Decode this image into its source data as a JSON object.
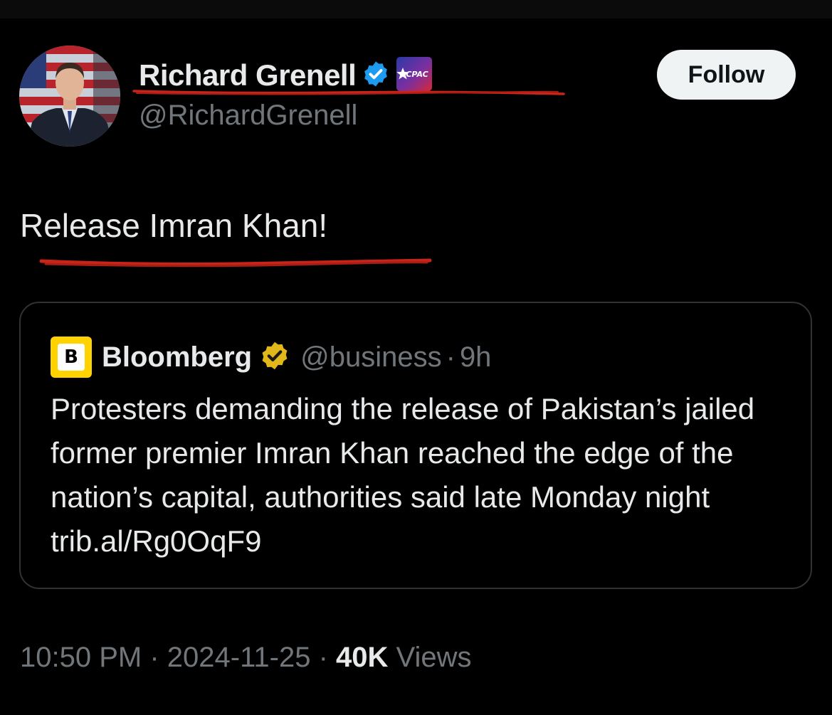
{
  "author": {
    "display_name": "Richard Grenell",
    "handle": "@RichardGrenell",
    "affiliate_badge_text": "CPAC"
  },
  "follow_button": {
    "label": "Follow"
  },
  "tweet": {
    "text": "Release Imran Khan!"
  },
  "quoted_tweet": {
    "logo_letter": "B",
    "name": "Bloomberg",
    "handle": "@business",
    "separator": "·",
    "time": "9h",
    "text": "Protesters demanding the release of Pakistan’s jailed former premier Imran Khan reached the edge of the nation’s capital, authorities said late Monday night trib.al/Rg0OqF9"
  },
  "meta": {
    "time": "10:50 PM",
    "separator": "·",
    "date": "2024-11-25",
    "views_count": "40K",
    "views_label": "Views"
  },
  "colors": {
    "background": "#000000",
    "text_primary": "#e7e9ea",
    "text_secondary": "#71767b",
    "verified_blue": "#1d9bf0",
    "verified_gold": "#e2b719",
    "annotation_red": "#c8241a",
    "follow_bg": "#eff3f4",
    "card_border": "#2f3336"
  },
  "icons": {
    "verified": "verified-badge-icon",
    "gold_verified": "gold-verified-badge-icon",
    "affiliate": "cpac-affiliate-badge-icon"
  }
}
